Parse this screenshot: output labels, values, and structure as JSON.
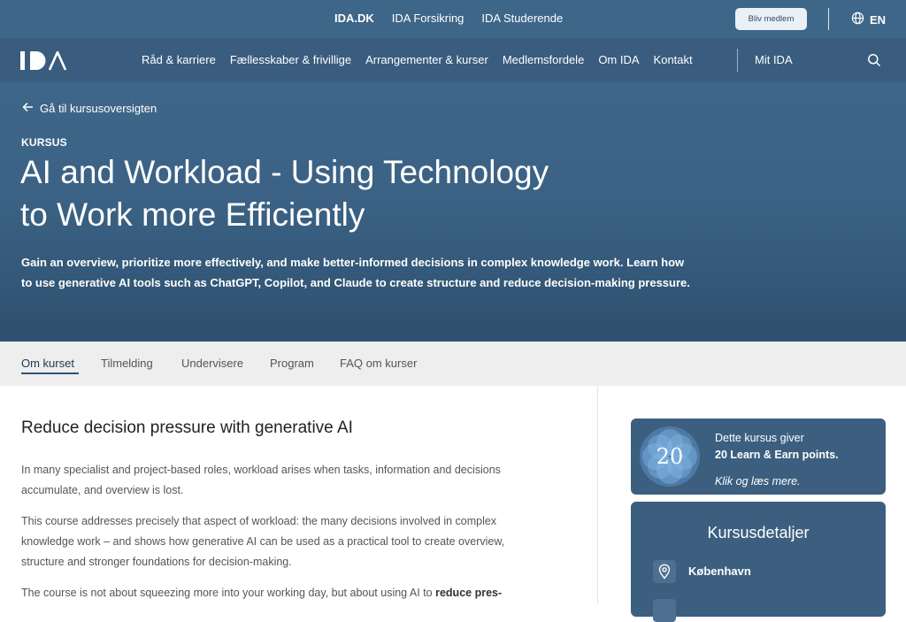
{
  "topbar": {
    "links": [
      "IDA.DK",
      "IDA Forsikring",
      "IDA Studerende"
    ],
    "cta": "Bliv medlem",
    "language": "EN",
    "language_icon": "globe-icon"
  },
  "nav": {
    "logo_text": "IDA",
    "items": [
      "Råd & karriere",
      "Fællesskaber & frivillige",
      "Arrangementer & kurser",
      "Medlemsfordele",
      "Om IDA",
      "Kontakt"
    ],
    "account": "Mit IDA",
    "search_icon": "search-icon"
  },
  "hero": {
    "back_link": "Gå til kursusoversigten",
    "eyebrow": "KURSUS",
    "title_line1": "AI and Workload - Using Technology",
    "title_line2": "to Work more Efficiently",
    "lead_line1": "Gain an overview, prioritize more effectively, and make better-informed decisions in complex knowledge work. Learn how",
    "lead_line2": "to use generative AI tools such as ChatGPT, Copilot, and Claude to create structure and reduce decision-making pressure."
  },
  "tabs": [
    "Om kurset",
    "Tilmelding",
    "Undervisere",
    "Program",
    "FAQ om kurser"
  ],
  "content": {
    "heading": "Reduce decision pressure with generative AI",
    "p1_line1": "In many specialist and project-based roles, workload arises when tasks, information and decisions",
    "p1_line2": "accumulate, and overview is lost.",
    "p2_line1": "This course addresses precisely that aspect of workload: the many decisions involved in complex",
    "p2_line2": "knowledge work – and shows how generative AI can be used as a practical tool to create overview,",
    "p2_line3": "structure and stronger foundations for decision-making.",
    "p3_normal": "The course is not about squeezing more into your working day, but about using AI to ",
    "p3_bold": "reduce pres-"
  },
  "points_card": {
    "badge": "20",
    "line1": "Dette kursus giver",
    "line2": "20 Learn & Earn points.",
    "line3": "Klik og læs mere."
  },
  "details_card": {
    "heading": "Kursusdetaljer",
    "location": "København",
    "location_icon": "location-pin-icon"
  },
  "colors": {
    "topbar": "#3e6689",
    "nav": "#395c7f",
    "card": "#3c5f80",
    "tab_underline": "#2f5478"
  }
}
